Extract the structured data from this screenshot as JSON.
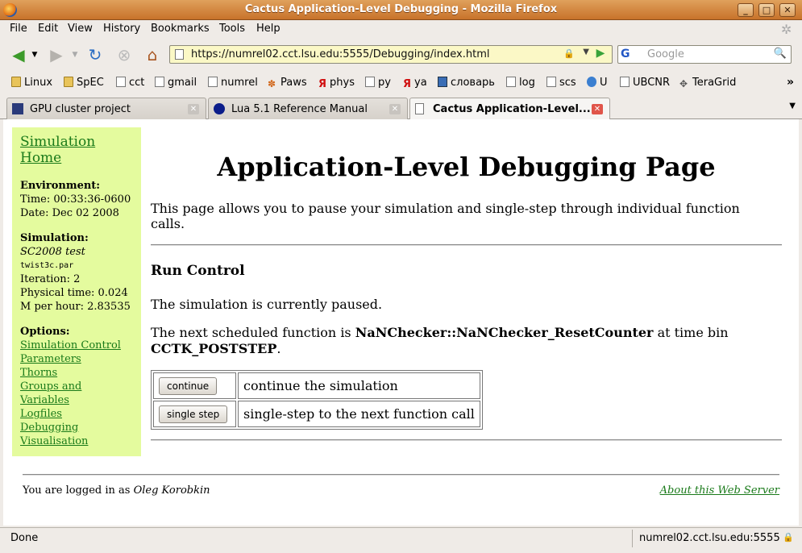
{
  "window": {
    "title": "Cactus Application-Level Debugging - Mozilla Firefox",
    "buttons": [
      "_",
      "□",
      "✕"
    ]
  },
  "menu": [
    "File",
    "Edit",
    "View",
    "History",
    "Bookmarks",
    "Tools",
    "Help"
  ],
  "nav": {
    "back": "back-icon",
    "forward": "forward-icon",
    "reload": "reload-icon",
    "stop": "stop-icon",
    "home": "home-icon",
    "url": "https://numrel02.cct.lsu.edu:5555/Debugging/index.html",
    "search_engine": "G",
    "search_placeholder": "Google"
  },
  "bookmarks": [
    "Linux",
    "SpEC",
    "cct",
    "gmail",
    "numrel",
    "Paws",
    "phys",
    "py",
    "ya",
    "словарь",
    "log",
    "scs",
    "U",
    "UBCNR",
    "TeraGrid"
  ],
  "tabs": [
    {
      "label": "GPU cluster project",
      "active": false
    },
    {
      "label": "Lua 5.1 Reference Manual",
      "active": false
    },
    {
      "label": "Cactus Application-Level...",
      "active": true
    }
  ],
  "sidebar": {
    "home_link": "Simulation Home",
    "environment_head": "Environment:",
    "time": "Time: 00:33:36-0600",
    "date": "Date: Dec 02 2008",
    "simulation_head": "Simulation:",
    "sim_name": "SC2008 test",
    "par_file": "twist3c.par",
    "iteration": "Iteration: 2",
    "physical_time": "Physical time: 0.024",
    "m_per_hour": "M per hour: 2.83535",
    "options_head": "Options:",
    "options": [
      "Simulation Control",
      "Parameters",
      "Thorns",
      "Groups and Variables",
      "Logfiles",
      "Debugging",
      "Visualisation"
    ]
  },
  "main": {
    "title": "Application-Level Debugging Page",
    "intro": "This page allows you to pause your simulation and single-step through individual function calls.",
    "run_control": "Run Control",
    "status": "The simulation is currently paused.",
    "next_prefix": "The next scheduled function is ",
    "next_function": "NaNChecker::NaNChecker_ResetCounter",
    "next_middle": " at time bin ",
    "next_bin": "CCTK_POSTSTEP",
    "next_suffix": ".",
    "controls": [
      {
        "button": "continue",
        "desc": "continue the simulation"
      },
      {
        "button": "single step",
        "desc": "single-step to the next function call"
      }
    ]
  },
  "footer": {
    "login_prefix": "You are logged in as ",
    "user": "Oleg Korobkin",
    "about": "About this Web Server"
  },
  "statusbar": {
    "status": "Done",
    "host": "numrel02.cct.lsu.edu:5555"
  }
}
